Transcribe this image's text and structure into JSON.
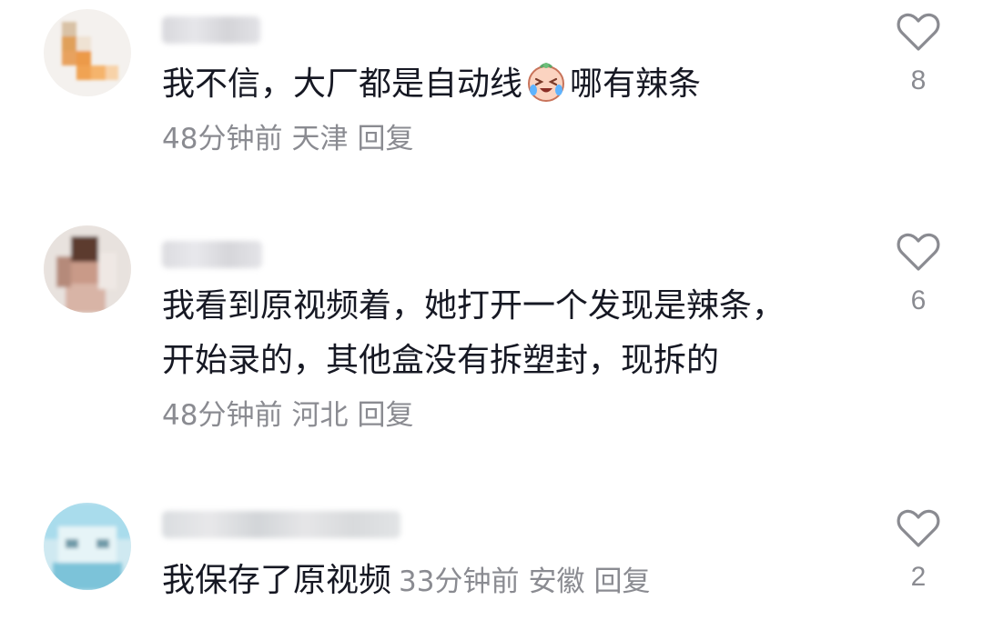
{
  "comments": [
    {
      "text_before_emoji": "我不信，大厂都是自动线",
      "emoji_icon": "crying-laughing-face-icon",
      "text_after_emoji": "哪有辣条",
      "time": "48分钟前",
      "location": "天津",
      "reply_label": "回复",
      "like_count": "8"
    },
    {
      "text_line1": "我看到原视频着，她打开一个发现是辣条，",
      "text_line2": "开始录的，其他盒没有拆塑封，现拆的",
      "time": "48分钟前",
      "location": "河北",
      "reply_label": "回复",
      "like_count": "6"
    },
    {
      "text": "我保存了原视频",
      "time": "33分钟前",
      "location": "安徽",
      "reply_label": "回复",
      "like_count": "2"
    }
  ],
  "icons": {
    "like": "heart-outline-icon"
  },
  "colors": {
    "text": "#161823",
    "meta": "#8a8b91",
    "background": "#ffffff"
  }
}
